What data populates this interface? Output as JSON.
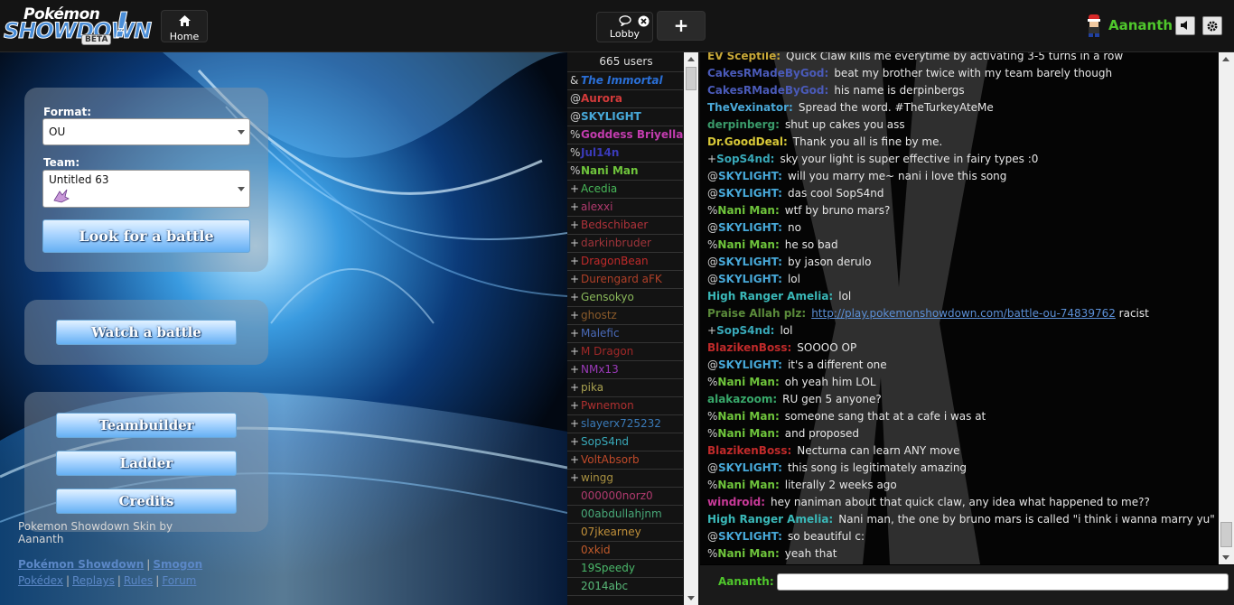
{
  "header": {
    "logo_line1": "Pokémon",
    "logo_line2": "SHOWDOWN",
    "logo_badge": "BETA",
    "home_label": "Home",
    "lobby_label": "Lobby",
    "add_label": "+",
    "username": "Aananth"
  },
  "left": {
    "format_label": "Format:",
    "format_value": "OU",
    "team_label": "Team:",
    "team_value": "Untitled 63",
    "look_button": "Look for a battle",
    "watch_button": "Watch a battle",
    "teambuilder_button": "Teambuilder",
    "ladder_button": "Ladder",
    "credits_button": "Credits",
    "skin_credit_line1": "Pokemon Showdown Skin by",
    "skin_credit_line2": "Aananth",
    "link_ps": "Pokémon Showdown",
    "link_smogon": "Smogon",
    "link_pokedex": "Pokédex",
    "link_replays": "Replays",
    "link_rules": "Rules",
    "link_forum": "Forum"
  },
  "userlist": {
    "count_text": "665 users",
    "users": [
      {
        "group": "&",
        "name": "The Immortal",
        "color": "#2a6fd6",
        "style": "bolditalic"
      },
      {
        "group": "@",
        "name": "Aurora",
        "color": "#d23a3a",
        "style": "bold"
      },
      {
        "group": "@",
        "name": "SKYLIGHT",
        "color": "#47a8d8",
        "style": "bold"
      },
      {
        "group": "%",
        "name": "Goddess Briyella",
        "color": "#c23cae",
        "style": "bold"
      },
      {
        "group": "%",
        "name": "Jul14n",
        "color": "#3a3ab8",
        "style": "bold"
      },
      {
        "group": "%",
        "name": "Nani Man",
        "color": "#6fc53c",
        "style": "bold"
      },
      {
        "group": "+",
        "name": "Acedia",
        "color": "#48b85a",
        "style": "normal"
      },
      {
        "group": "+",
        "name": "alexxi",
        "color": "#b03a6e",
        "style": "normal"
      },
      {
        "group": "+",
        "name": "Bedschibaer",
        "color": "#b0323a",
        "style": "normal"
      },
      {
        "group": "+",
        "name": "darkinbruder",
        "color": "#a0343a",
        "style": "normal"
      },
      {
        "group": "+",
        "name": "DragonBean",
        "color": "#c02a2a",
        "style": "normal"
      },
      {
        "group": "+",
        "name": "Durengard aFK",
        "color": "#b04028",
        "style": "normal"
      },
      {
        "group": "+",
        "name": "Gensokyo",
        "color": "#8ab85a",
        "style": "normal"
      },
      {
        "group": "+",
        "name": "ghostz",
        "color": "#8a5a2a",
        "style": "normal"
      },
      {
        "group": "+",
        "name": "Malefic",
        "color": "#4a6ab8",
        "style": "normal"
      },
      {
        "group": "+",
        "name": "M Dragon",
        "color": "#a02828",
        "style": "normal"
      },
      {
        "group": "+",
        "name": "NMx13",
        "color": "#9a3ab8",
        "style": "normal"
      },
      {
        "group": "+",
        "name": "pika",
        "color": "#a8a050",
        "style": "normal"
      },
      {
        "group": "+",
        "name": "Pwnemon",
        "color": "#b03030",
        "style": "normal"
      },
      {
        "group": "+",
        "name": "slayerx725232",
        "color": "#3a7ab8",
        "style": "normal"
      },
      {
        "group": "+",
        "name": "SopS4nd",
        "color": "#38a8b8",
        "style": "normal"
      },
      {
        "group": "+",
        "name": "VoltAbsorb",
        "color": "#c04a2a",
        "style": "normal"
      },
      {
        "group": "+",
        "name": "wingg",
        "color": "#a89040",
        "style": "normal"
      },
      {
        "group": "",
        "name": "000000norz0",
        "color": "#b03a6e",
        "style": "normal"
      },
      {
        "group": "",
        "name": "00abdullahjnm",
        "color": "#48a878",
        "style": "normal"
      },
      {
        "group": "",
        "name": "07jkearney",
        "color": "#c0903a",
        "style": "normal"
      },
      {
        "group": "",
        "name": "0xkid",
        "color": "#c05a2a",
        "style": "normal"
      },
      {
        "group": "",
        "name": "19Speedy",
        "color": "#4ab86a",
        "style": "normal"
      },
      {
        "group": "",
        "name": "2014abc",
        "color": "#58b878",
        "style": "normal"
      }
    ]
  },
  "chat": {
    "input_name": "Aananth:",
    "messages": [
      {
        "group": "",
        "user": "EV Sceptile:",
        "color": "#c8a838",
        "text": "Quick Claw kills me everytime by activating 3-5 turns in a row"
      },
      {
        "group": "",
        "user": "CakesRMadeByGod:",
        "color": "#4a5ab8",
        "text": "beat my brother twice with my team barely though"
      },
      {
        "group": "",
        "user": "CakesRMadeByGod:",
        "color": "#4a5ab8",
        "text": "his name is derpinbergs"
      },
      {
        "group": "",
        "user": "TheVexinator:",
        "color": "#4aa8d8",
        "text": "Spread the word. #TheTurkeyAteMe"
      },
      {
        "group": "",
        "user": "derpinberg:",
        "color": "#3a9a6a",
        "text": "shut up cakes you ass"
      },
      {
        "group": "",
        "user": "Dr.GoodDeal:",
        "color": "#d8c838",
        "text": "Thank you all is fine by me."
      },
      {
        "group": "+",
        "user": "SopS4nd:",
        "color": "#38a8b8",
        "text": "sky your light is super effective in fairy types :0"
      },
      {
        "group": "@",
        "user": "SKYLIGHT:",
        "color": "#47a8d8",
        "text": "will you marry me~ nani i love this song"
      },
      {
        "group": "@",
        "user": "SKYLIGHT:",
        "color": "#47a8d8",
        "text": "das cool SopS4nd"
      },
      {
        "group": "%",
        "user": "Nani Man:",
        "color": "#6fc53c",
        "text": "wtf by bruno mars?"
      },
      {
        "group": "@",
        "user": "SKYLIGHT:",
        "color": "#47a8d8",
        "text": "no"
      },
      {
        "group": "%",
        "user": "Nani Man:",
        "color": "#6fc53c",
        "text": "he so bad"
      },
      {
        "group": "@",
        "user": "SKYLIGHT:",
        "color": "#47a8d8",
        "text": "by jason derulo"
      },
      {
        "group": "@",
        "user": "SKYLIGHT:",
        "color": "#47a8d8",
        "text": "lol"
      },
      {
        "group": "",
        "user": "High Ranger Amelia:",
        "color": "#3ab8b8",
        "text": "lol"
      },
      {
        "group": "",
        "user": "Praise Allah plz:",
        "color": "#5a8a3a",
        "text": "",
        "link": "http://play.pokemonshowdown.com/battle-ou-74839762",
        "after": "racist"
      },
      {
        "group": "+",
        "user": "SopS4nd:",
        "color": "#38a8b8",
        "text": "lol"
      },
      {
        "group": "",
        "user": "BlazikenBoss:",
        "color": "#c02a2a",
        "text": "SOOOO OP"
      },
      {
        "group": "@",
        "user": "SKYLIGHT:",
        "color": "#47a8d8",
        "text": "it's a different one"
      },
      {
        "group": "%",
        "user": "Nani Man:",
        "color": "#6fc53c",
        "text": "oh yeah him LOL"
      },
      {
        "group": "",
        "user": "alakazoom:",
        "color": "#38a86a",
        "text": "RU gen 5 anyone?"
      },
      {
        "group": "%",
        "user": "Nani Man:",
        "color": "#6fc53c",
        "text": "someone sang that at a cafe i was at"
      },
      {
        "group": "%",
        "user": "Nani Man:",
        "color": "#6fc53c",
        "text": "and proposed"
      },
      {
        "group": "",
        "user": "BlazikenBoss:",
        "color": "#c02a2a",
        "text": "Necturna can learn ANY move"
      },
      {
        "group": "@",
        "user": "SKYLIGHT:",
        "color": "#47a8d8",
        "text": "this song is legitimately amazing"
      },
      {
        "group": "%",
        "user": "Nani Man:",
        "color": "#6fc53c",
        "text": "literally 2 weeks ago"
      },
      {
        "group": "",
        "user": "windroid:",
        "color": "#c83a98",
        "text": "hey naniman about that quick claw, any idea what happened to me??"
      },
      {
        "group": "",
        "user": "High Ranger Amelia:",
        "color": "#3ab8b8",
        "text": "Nani man, the one by bruno mars is called \"i think i wanna marry yu\""
      },
      {
        "group": "@",
        "user": "SKYLIGHT:",
        "color": "#47a8d8",
        "text": "so beautiful c:"
      },
      {
        "group": "%",
        "user": "Nani Man:",
        "color": "#6fc53c",
        "text": "yeah that"
      }
    ]
  }
}
